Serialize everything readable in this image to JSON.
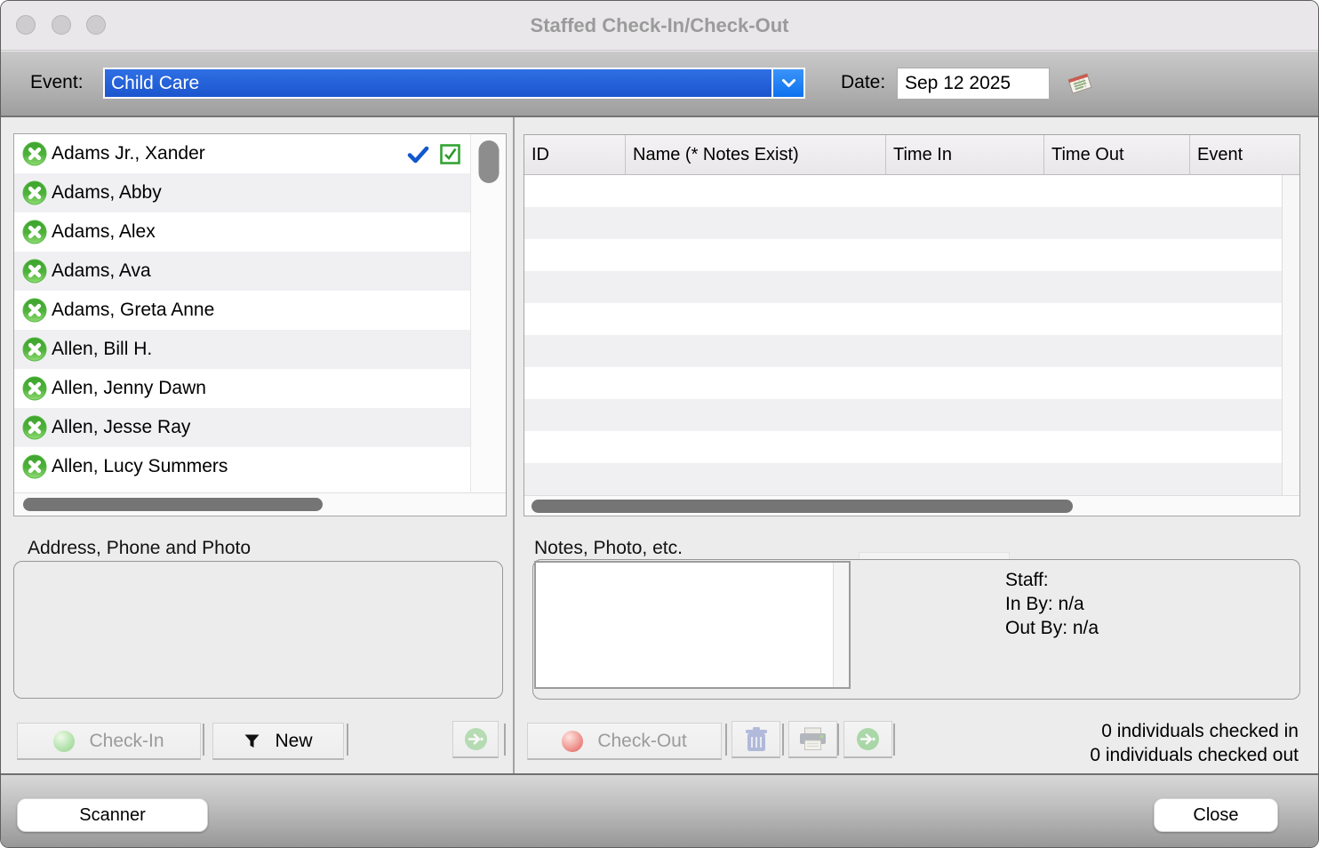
{
  "window": {
    "title": "Staffed Check-In/Check-Out"
  },
  "toolbar": {
    "event_label": "Event:",
    "event_value": "Child Care",
    "date_label": "Date:",
    "date_value": "Sep 12 2025"
  },
  "left_panel": {
    "rows": [
      {
        "name": "Adams Jr., Xander",
        "selected": true
      },
      {
        "name": "Adams, Abby",
        "selected": false
      },
      {
        "name": "Adams, Alex",
        "selected": false
      },
      {
        "name": "Adams, Ava",
        "selected": false
      },
      {
        "name": "Adams, Greta Anne",
        "selected": false
      },
      {
        "name": "Allen, Bill H.",
        "selected": false
      },
      {
        "name": "Allen, Jenny Dawn",
        "selected": false
      },
      {
        "name": "Allen, Jesse Ray",
        "selected": false
      },
      {
        "name": "Allen, Lucy Summers",
        "selected": false
      }
    ],
    "address_label": "Address, Phone and Photo",
    "check_in_button": "Check-In",
    "new_button": "New"
  },
  "right_panel": {
    "table_headers": [
      "ID",
      "Name (* Notes Exist)",
      "Time In",
      "Time Out",
      "Event"
    ],
    "table_rows": [],
    "notes_label": "Notes, Photo, etc.",
    "staff": {
      "staff_label": "Staff:",
      "in_by": "In By: n/a",
      "out_by": "Out By: n/a"
    },
    "check_out_button": "Check-Out",
    "checked_in_count": "0 individuals checked in",
    "checked_out_count": "0 individuals checked out"
  },
  "footer": {
    "scanner_button": "Scanner",
    "close_button": "Close"
  },
  "colors": {
    "event_select_blue": "#2363dd",
    "select_arrow_blue": "#1b82f7",
    "selected_check_blue": "#1257cc",
    "status_icon_green": "#49a832",
    "check_in_ball_green": "#95d18f",
    "check_out_ball_red": "#e25a55",
    "row_stripe_gray": "#f0f0f3"
  }
}
